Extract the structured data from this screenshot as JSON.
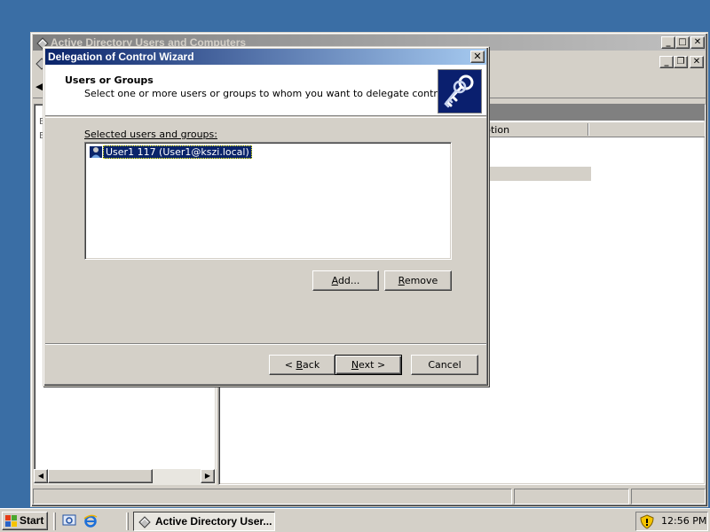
{
  "background_window": {
    "title": "Active Directory Users and Computers",
    "column_header": "ption"
  },
  "dialog": {
    "title": "Delegation of Control Wizard",
    "close_label": "✕",
    "header_title": "Users or Groups",
    "header_subtitle": "Select one or more users or groups to whom you want to delegate control.",
    "list_label": "Selected users and groups:",
    "list_items": [
      {
        "label": "User1 117 (User1@kszi.local)",
        "selected": true
      }
    ],
    "add_button": {
      "mnemonic": "A",
      "rest": "dd..."
    },
    "remove_button": {
      "mnemonic": "R",
      "rest": "emove"
    },
    "back_button": {
      "prefix": "< ",
      "mnemonic": "B",
      "rest": "ack"
    },
    "next_button": {
      "mnemonic": "N",
      "rest": "ext >"
    },
    "cancel_button": "Cancel"
  },
  "taskbar": {
    "start_label": "Start",
    "task_label": "Active Directory User...",
    "clock": "12:56 PM"
  },
  "colors": {
    "desktop": "#3a6ea5",
    "title_active": "#0a246a",
    "title_inactive": "#808080",
    "face": "#d4d0c8",
    "selection": "#0a246a"
  }
}
